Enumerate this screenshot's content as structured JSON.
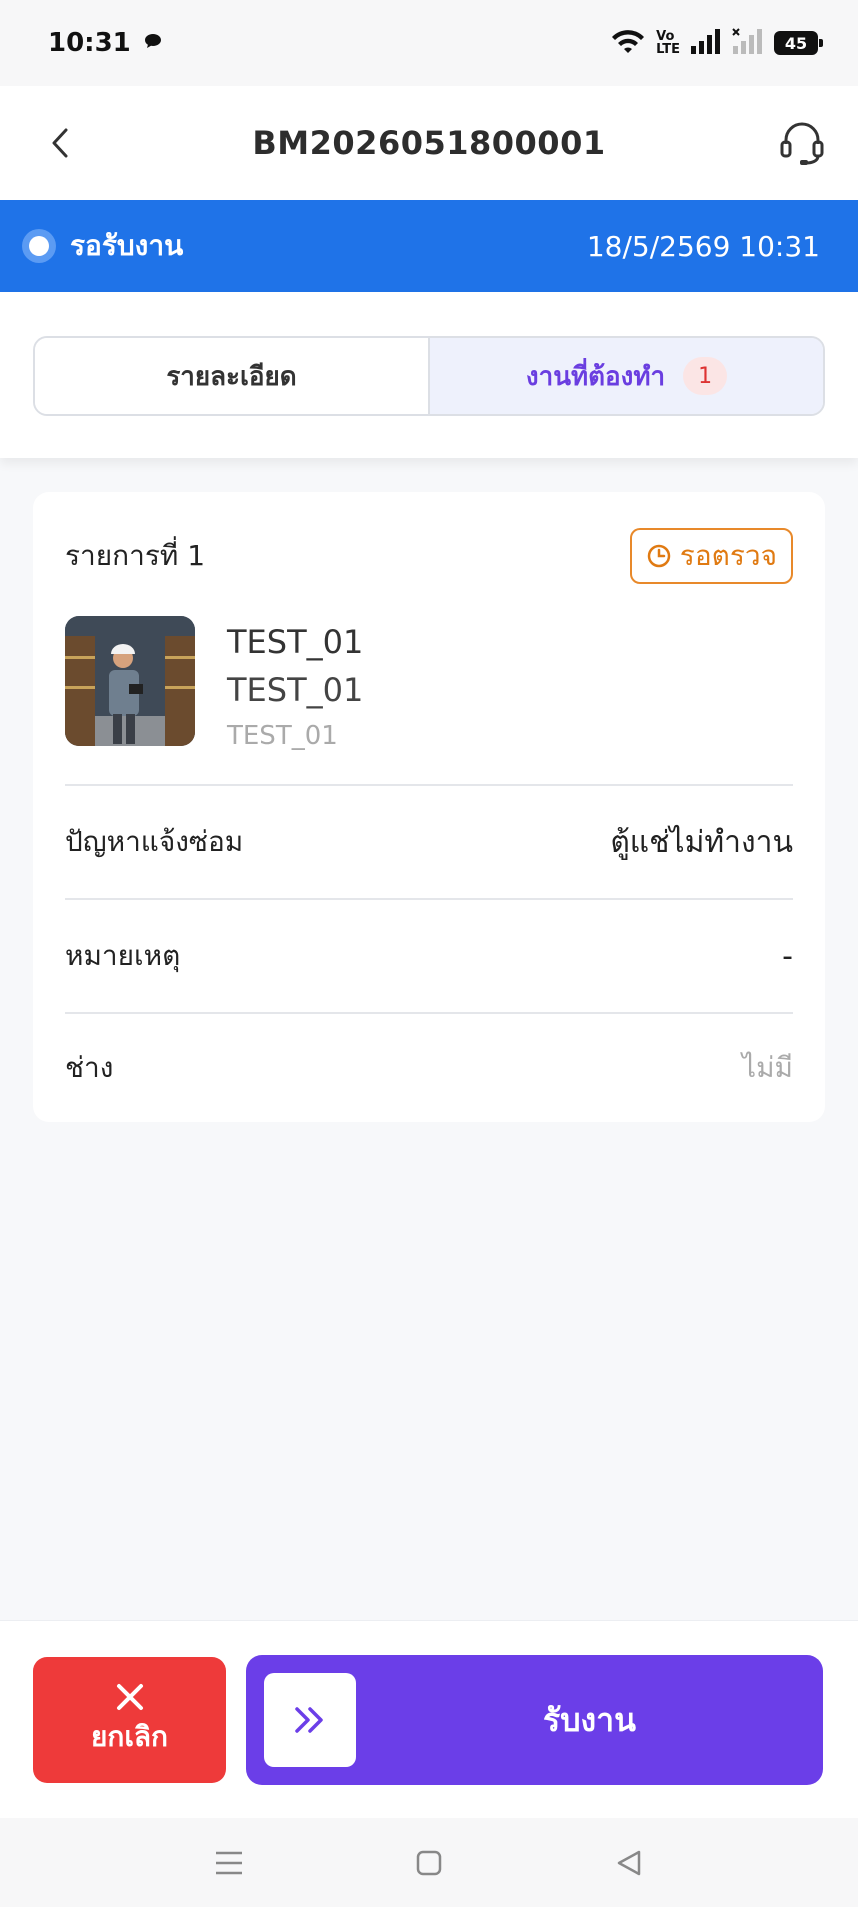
{
  "status_bar": {
    "time": "10:31",
    "volte": [
      "Vo",
      "LTE"
    ],
    "battery": "45",
    "icons": [
      "chat-bubble-icon",
      "wifi-icon",
      "signal-icon",
      "no-signal-icon",
      "battery-icon"
    ]
  },
  "header": {
    "title": "BM2026051800001",
    "back_icon": "chevron-left-icon",
    "support_icon": "headset-icon"
  },
  "banner": {
    "status": "รอรับงาน",
    "datetime": "18/5/2569 10:31",
    "color": "#1f73e8"
  },
  "tabs": [
    {
      "label": "รายละเอียด",
      "active": false
    },
    {
      "label": "งานที่ต้องทำ",
      "active": true,
      "badge": "1"
    }
  ],
  "card": {
    "title": "รายการที่ 1",
    "status_badge": "รอตรวจ",
    "status_color": "#e07a12",
    "product": {
      "line1": "TEST_01",
      "line2": "TEST_01",
      "line3": "TEST_01"
    },
    "rows": [
      {
        "label": "ปัญหาแจ้งซ่อม",
        "value": "ตู้แช่ไม่ทำงาน"
      },
      {
        "label": "หมายเหตุ",
        "value": "-"
      },
      {
        "label": "ช่าง",
        "value": "ไม่มี"
      }
    ]
  },
  "actions": {
    "cancel_label": "ยกเลิก",
    "accept_label": "รับงาน",
    "cancel_color": "#ee3a3a",
    "accept_color": "#6b3ee8"
  }
}
